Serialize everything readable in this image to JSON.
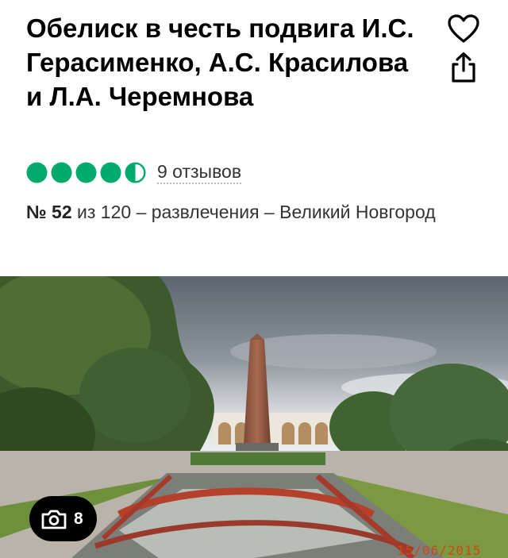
{
  "title": "Обелиск в честь подвига И.С. Герасименко, А.С. Красилова и Л.А. Черемнова",
  "rating": {
    "filled": 4.5,
    "max": 5,
    "color": "#00aa6c"
  },
  "reviews_text": "9 отзывов",
  "ranking": {
    "number": "№ 52",
    "text": " из 120 – развлечения – Великий Новгород"
  },
  "photo": {
    "count": "8",
    "date_stamp": "15/06/2015"
  },
  "icons": {
    "favorite": "heart-outline-icon",
    "share": "share-icon",
    "photos": "camera-icon"
  }
}
